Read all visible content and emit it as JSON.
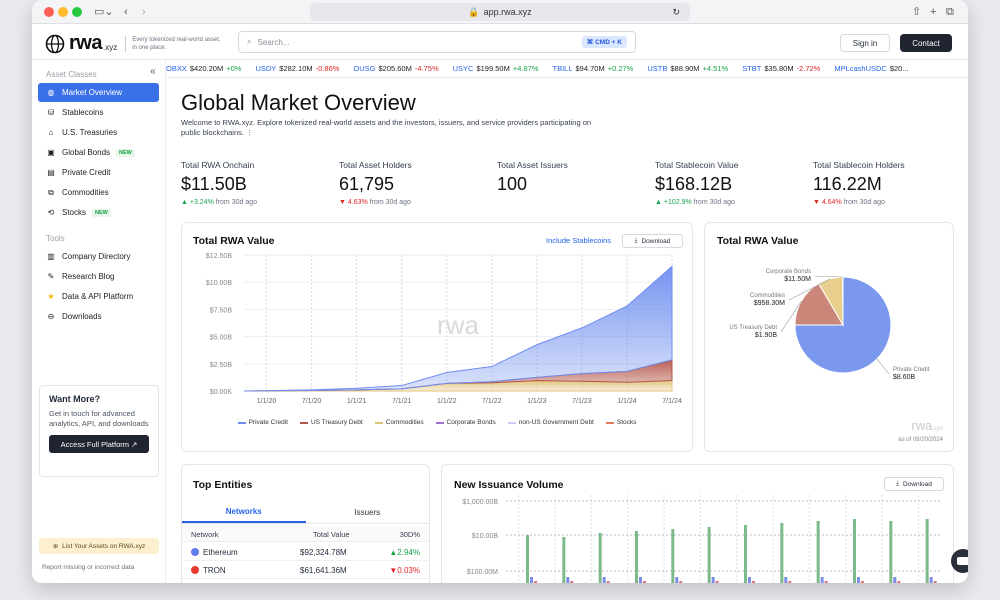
{
  "browser": {
    "url": "app.rwa.xyz"
  },
  "header": {
    "logo": "rwa",
    "logo_suffix": ".xyz",
    "tagline": "Every tokenized real-world asset, in one place.",
    "search_placeholder": "Search...",
    "search_shortcut": "⌘ CMD + K",
    "sign_in": "Sign in",
    "contact": "Contact"
  },
  "sidebar": {
    "asset_classes_label": "Asset Classes",
    "asset_items": [
      {
        "label": "Market Overview",
        "icon": "globe-icon",
        "active": true
      },
      {
        "label": "Stablecoins",
        "icon": "coins-icon"
      },
      {
        "label": "U.S. Treasuries",
        "icon": "bank-icon"
      },
      {
        "label": "Global Bonds",
        "icon": "bond-icon",
        "badge": "NEW"
      },
      {
        "label": "Private Credit",
        "icon": "document-icon"
      },
      {
        "label": "Commodities",
        "icon": "commodities-icon"
      },
      {
        "label": "Stocks",
        "icon": "stocks-icon",
        "badge": "NEW"
      }
    ],
    "tools_label": "Tools",
    "tool_items": [
      {
        "label": "Company Directory",
        "icon": "building-icon"
      },
      {
        "label": "Research Blog",
        "icon": "blog-icon"
      },
      {
        "label": "Data & API Platform",
        "icon": "star-icon"
      },
      {
        "label": "Downloads",
        "icon": "download-icon"
      }
    ],
    "want_more": {
      "title": "Want More?",
      "text": "Get in touch for advanced analytics, API, and downloads",
      "button": "Access Full Platform ↗"
    },
    "list_assets": "List Your Assets on RWA.xyz",
    "report": "Report missing or incorrect data"
  },
  "ticker": [
    {
      "sym": "OBXX",
      "val": "$420.20M",
      "chg": "+0%",
      "dir": "up"
    },
    {
      "sym": "USDY",
      "val": "$282.10M",
      "chg": "-0.86%",
      "dir": "down"
    },
    {
      "sym": "OUSG",
      "val": "$205.60M",
      "chg": "-4.75%",
      "dir": "down"
    },
    {
      "sym": "USYC",
      "val": "$199.50M",
      "chg": "+4.87%",
      "dir": "up"
    },
    {
      "sym": "TBILL",
      "val": "$94.70M",
      "chg": "+0.27%",
      "dir": "up"
    },
    {
      "sym": "USTB",
      "val": "$88.90M",
      "chg": "+4.51%",
      "dir": "up"
    },
    {
      "sym": "STBT",
      "val": "$35.80M",
      "chg": "-2.72%",
      "dir": "down"
    },
    {
      "sym": "MPLcashUSDC",
      "val": "$20...",
      "chg": "",
      "dir": "up"
    }
  ],
  "page": {
    "title": "Global Market Overview",
    "intro": "Welcome to RWA.xyz. Explore tokenized real-world assets and the investors, issuers, and service providers participating on public blockchains."
  },
  "stats": [
    {
      "label": "Total RWA Onchain",
      "value": "$11.50B",
      "change": "▲ +3.24%",
      "suffix": " from 30d ago",
      "dir": "up"
    },
    {
      "label": "Total Asset Holders",
      "value": "61,795",
      "change": "▼ 4.63%",
      "suffix": " from 30d ago",
      "dir": "down"
    },
    {
      "label": "Total Asset Issuers",
      "value": "100",
      "change": "",
      "suffix": "",
      "dir": "up"
    },
    {
      "label": "Total Stablecoin Value",
      "value": "$168.12B",
      "change": "▲ +102.9%",
      "suffix": " from 30d ago",
      "dir": "up"
    },
    {
      "label": "Total Stablecoin Holders",
      "value": "116.22M",
      "change": "▼ 4.64%",
      "suffix": " from 30d ago",
      "dir": "down"
    }
  ],
  "rwa_card": {
    "title": "Total RWA Value",
    "include_link": "Include Stablecoins",
    "download": "Download",
    "watermark": "rwa",
    "watermark_suffix": ".xyz"
  },
  "pie_card": {
    "title": "Total RWA Value",
    "asof": "as of 08/20/2024",
    "watermark": "rwa",
    "watermark_suffix": ".xyz"
  },
  "entities": {
    "title": "Top Entities",
    "tabs": [
      "Networks",
      "Issuers"
    ],
    "columns": [
      "Network",
      "Total Value",
      "30D%"
    ],
    "rows": [
      {
        "name": "Ethereum",
        "value": "$92,324.78M",
        "chg": "▲2.94%",
        "dir": "up",
        "color": "#627eea",
        "icon": "ethereum-icon"
      },
      {
        "name": "TRON",
        "value": "$61,641.36M",
        "chg": "▼0.03%",
        "dir": "down",
        "color": "#e5392d",
        "icon": "tron-icon"
      }
    ]
  },
  "issuance": {
    "title": "New Issuance Volume",
    "download": "Download"
  },
  "colors": {
    "accent": "#3b71e8",
    "private_credit": "#6f8ef0",
    "treasury": "#b5574a",
    "commodities": "#e2c27a",
    "bar_green": "#7cba8a",
    "bar_blue": "#7d8de8",
    "bar_red": "#d67a7a"
  },
  "chart_data": [
    {
      "type": "area",
      "title": "Total RWA Value",
      "x": [
        "1/1/20",
        "7/1/20",
        "1/1/21",
        "7/1/21",
        "1/1/22",
        "7/1/22",
        "1/1/23",
        "7/1/23",
        "1/1/24",
        "7/1/24"
      ],
      "ylim": [
        0,
        12500000000
      ],
      "yticks": [
        "$12.50B",
        "$10.00B",
        "$7.50B",
        "$5.00B",
        "$2.50B",
        "$0.00K"
      ],
      "series": [
        {
          "name": "Private Credit",
          "color": "#6f8ef0",
          "values": [
            0,
            0.05,
            0.15,
            0.3,
            1.0,
            1.4,
            3.0,
            4.2,
            6.0,
            8.6
          ]
        },
        {
          "name": "US Treasury Debt",
          "color": "#b5574a",
          "values": [
            0,
            0,
            0,
            0,
            0,
            0.1,
            0.3,
            0.7,
            1.0,
            1.9
          ]
        },
        {
          "name": "Commodities",
          "color": "#e2c27a",
          "values": [
            0,
            0.05,
            0.1,
            0.2,
            0.7,
            0.75,
            0.95,
            0.9,
            0.8,
            0.96
          ]
        },
        {
          "name": "Corporate Bonds",
          "color": "#9b6fd4",
          "values": [
            0,
            0,
            0,
            0,
            0,
            0,
            0,
            0,
            0,
            0
          ]
        },
        {
          "name": "non-US Government Debt",
          "color": "#c7cff5",
          "values": [
            0,
            0,
            0,
            0,
            0,
            0,
            0,
            0,
            0,
            0
          ]
        },
        {
          "name": "Stocks",
          "color": "#e07a5f",
          "values": [
            0,
            0,
            0,
            0,
            0,
            0,
            0,
            0,
            0,
            0
          ]
        }
      ]
    },
    {
      "type": "pie",
      "title": "Total RWA Value",
      "labels": [
        "Private Credit",
        "US Treasury Debt",
        "Commodities",
        "Corporate Bonds"
      ],
      "values_text": [
        "$8.60B",
        "$1.90B",
        "$958.30M",
        "$11.50M"
      ],
      "values": [
        8.6,
        1.9,
        0.9583,
        0.0115
      ],
      "colors": [
        "#7b98ef",
        "#c98679",
        "#e8cf8e",
        "#d8d8d8"
      ]
    },
    {
      "type": "bar",
      "title": "New Issuance Volume",
      "yticks": [
        "$1,000.00B",
        "$10.00B",
        "$100.00M"
      ],
      "scale": "log"
    }
  ]
}
